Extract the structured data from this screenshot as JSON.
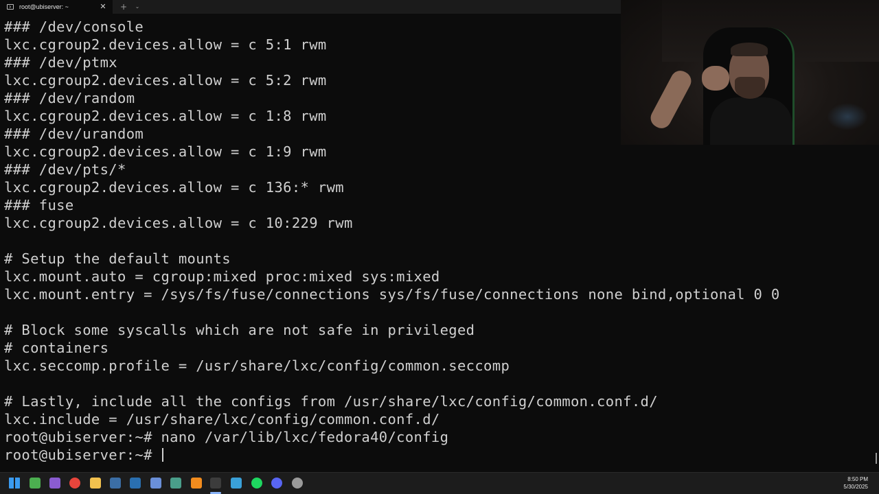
{
  "window": {
    "tab_title": "root@ubiserver: ~",
    "tab_close_glyph": "✕",
    "tab_add_glyph": "+",
    "tab_dropdown_glyph": "⌄"
  },
  "terminal": {
    "lines": [
      "### /dev/console",
      "lxc.cgroup2.devices.allow = c 5:1 rwm",
      "### /dev/ptmx",
      "lxc.cgroup2.devices.allow = c 5:2 rwm",
      "### /dev/random",
      "lxc.cgroup2.devices.allow = c 1:8 rwm",
      "### /dev/urandom",
      "lxc.cgroup2.devices.allow = c 1:9 rwm",
      "### /dev/pts/*",
      "lxc.cgroup2.devices.allow = c 136:* rwm",
      "### fuse",
      "lxc.cgroup2.devices.allow = c 10:229 rwm",
      "",
      "# Setup the default mounts",
      "lxc.mount.auto = cgroup:mixed proc:mixed sys:mixed",
      "lxc.mount.entry = /sys/fs/fuse/connections sys/fs/fuse/connections none bind,optional 0 0",
      "",
      "# Block some syscalls which are not safe in privileged",
      "# containers",
      "lxc.seccomp.profile = /usr/share/lxc/config/common.seccomp",
      "",
      "# Lastly, include all the configs from /usr/share/lxc/config/common.conf.d/",
      "lxc.include = /usr/share/lxc/config/common.conf.d/",
      "root@ubiserver:~# nano /var/lib/lxc/fedora40/config",
      "root@ubiserver:~# "
    ]
  },
  "taskbar": {
    "icons": [
      {
        "name": "windows-start-icon",
        "color": "#3a9bf0"
      },
      {
        "name": "notepad-plus-icon",
        "color": "#4caf50"
      },
      {
        "name": "visual-studio-icon",
        "color": "#8a5cd1"
      },
      {
        "name": "chrome-icon",
        "color": "#e8453c"
      },
      {
        "name": "file-explorer-icon",
        "color": "#f2c14e"
      },
      {
        "name": "app-icon",
        "color": "#3b6ea5"
      },
      {
        "name": "powershell-icon",
        "color": "#2a6fb0"
      },
      {
        "name": "save-disk-icon",
        "color": "#6a8fd8"
      },
      {
        "name": "snipping-tool-icon",
        "color": "#4a9e8a"
      },
      {
        "name": "vlc-icon",
        "color": "#f28c1e"
      },
      {
        "name": "terminal-icon",
        "color": "#3c3c3c"
      },
      {
        "name": "package-icon",
        "color": "#3aa0d8"
      },
      {
        "name": "spotify-icon",
        "color": "#1ed760"
      },
      {
        "name": "discord-icon",
        "color": "#5865f2"
      },
      {
        "name": "settings-icon",
        "color": "#9a9a9a"
      }
    ],
    "clock_time": "8:50 PM",
    "clock_date": "5/30/2025"
  }
}
